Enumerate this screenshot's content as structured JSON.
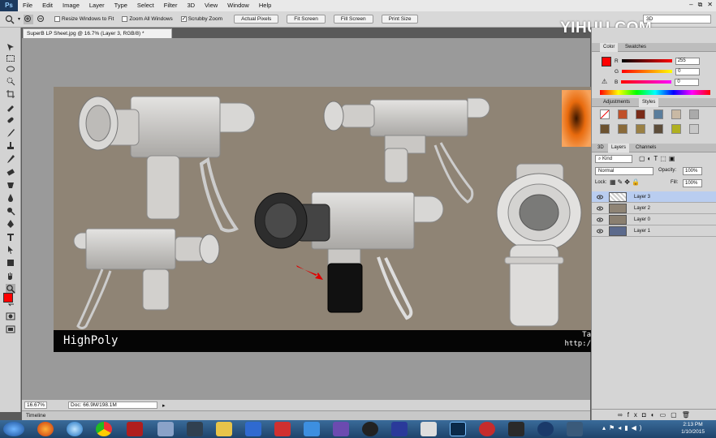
{
  "menubar": {
    "logo": "Ps",
    "items": [
      "File",
      "Edit",
      "Image",
      "Layer",
      "Type",
      "Select",
      "Filter",
      "3D",
      "View",
      "Window",
      "Help"
    ],
    "controls": [
      "–",
      "⧉",
      "✕"
    ]
  },
  "options": {
    "resize_windows": "Resize Windows to Fit",
    "zoom_all": "Zoom All Windows",
    "scrubby_zoom": "Scrubby Zoom",
    "scrubby_checked": "✓",
    "actual_pixels": "Actual Pixels",
    "fit_screen": "Fit Screen",
    "fill_screen": "Fill Screen",
    "print_size": "Print Size",
    "workspace": "3D"
  },
  "watermark": "YIHUU.COM",
  "document": {
    "tab_title": "SuperB LP Sheet.jpg @ 16.7% (Layer 3, RGB/8) *",
    "caption": "HighPoly",
    "caption_right_1": "Ta",
    "caption_right_2": "http:/"
  },
  "status": {
    "zoom": "16.67%",
    "doc": "Doc: 66.9M/198.1M"
  },
  "timeline": "Timeline",
  "color_panel": {
    "tabs": [
      "Color",
      "Swatches"
    ],
    "r_label": "R",
    "r_value": "255",
    "g_label": "G",
    "g_value": "0",
    "b_label": "B",
    "b_value": "0",
    "foreground": "#ff0000"
  },
  "adjust_panel": {
    "tabs": [
      "Adjustments",
      "Styles"
    ]
  },
  "layers_panel": {
    "tabs": [
      "3D",
      "Layers",
      "Channels"
    ],
    "kind": "Kind",
    "blend_mode": "Normal",
    "opacity_label": "Opacity:",
    "opacity": "100%",
    "lock_label": "Lock:",
    "fill_label": "Fill:",
    "fill": "100%",
    "layers": [
      {
        "name": "Layer 3",
        "selected": true
      },
      {
        "name": "Layer 2",
        "selected": false
      },
      {
        "name": "Layer 0",
        "selected": false
      },
      {
        "name": "Layer 1",
        "selected": false
      }
    ]
  },
  "taskbar": {
    "time": "2:13 PM",
    "date": "1/10/2015"
  },
  "colors": {
    "accent_red": "#ff0000",
    "layer_selected": "#b9cdf0"
  }
}
